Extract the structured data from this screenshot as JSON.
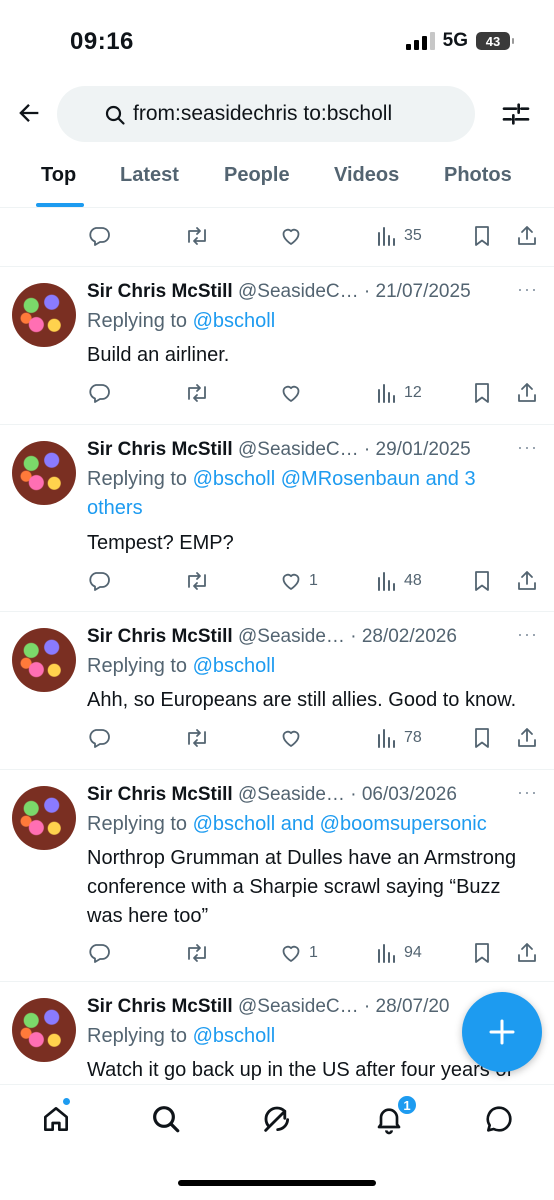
{
  "status_bar": {
    "time": "09:16",
    "network": "5G",
    "battery": "43"
  },
  "search": {
    "query": "from:seasidechris to:bscholl",
    "placeholder": "Search"
  },
  "tabs": [
    {
      "label": "Top",
      "active": true
    },
    {
      "label": "Latest"
    },
    {
      "label": "People"
    },
    {
      "label": "Videos"
    },
    {
      "label": "Photos"
    }
  ],
  "partial_tweet": {
    "views": "35"
  },
  "tweets": [
    {
      "name": "Sir Chris McStill",
      "handle_date": "@SeasideC… · 21/07/2025",
      "replying_prefix": "Replying to ",
      "replying_to": "@bscholl",
      "text": "Build an airliner.",
      "likes": "",
      "views": "12"
    },
    {
      "name": "Sir Chris McStill",
      "handle_date": "@SeasideC… · 29/01/2025",
      "replying_prefix": "Replying to ",
      "replying_to": "@bscholl @MRosenbaun and 3 others",
      "text": "Tempest? EMP?",
      "likes": "1",
      "views": "48"
    },
    {
      "name": "Sir Chris McStill",
      "handle_date": "@Seaside… · 28/02/2026",
      "replying_prefix": "Replying to ",
      "replying_to": "@bscholl",
      "text": "Ahh, so Europeans are still allies. Good to know.",
      "likes": "",
      "views": "78"
    },
    {
      "name": "Sir Chris McStill",
      "handle_date": "@Seaside… · 06/03/2026",
      "replying_prefix": "Replying to ",
      "replying_to": "@bscholl and @boomsupersonic",
      "text": "Northrop Grumman at Dulles have an Armstrong conference with a Sharpie scrawl saying “Buzz was here too”",
      "likes": "1",
      "views": "94"
    },
    {
      "name": "Sir Chris McStill",
      "handle_date": "@SeasideC… · 28/07/20",
      "replying_prefix": "Replying to ",
      "replying_to": "@bscholl",
      "text": "Watch it go back up in the US after four years of"
    }
  ],
  "more_label": "···",
  "notifications": {
    "count": "1"
  },
  "colors": {
    "accent": "#1d9bf0",
    "text_primary": "#0f1419",
    "text_secondary": "#536471"
  },
  "icons": {
    "back": "arrow-left-icon",
    "search": "search-icon",
    "filter": "filter-sliders-icon",
    "reply": "reply-icon",
    "retweet": "retweet-icon",
    "like": "heart-icon",
    "views": "views-icon",
    "bookmark": "bookmark-icon",
    "share": "share-icon",
    "compose": "plus-icon",
    "home": "home-icon",
    "explore": "search-icon",
    "grok": "grok-icon",
    "notifications": "bell-icon",
    "messages": "message-icon"
  }
}
